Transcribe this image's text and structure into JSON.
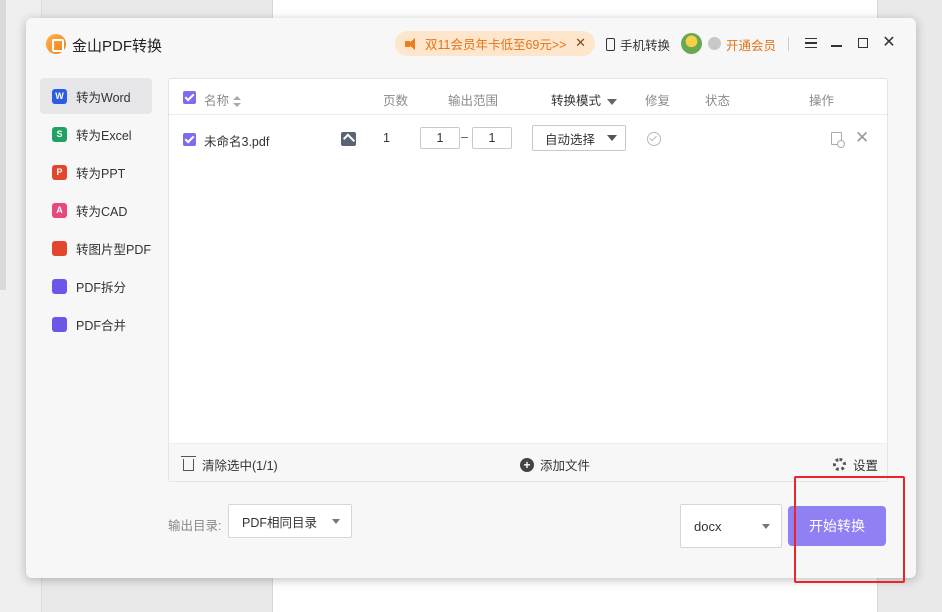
{
  "app": {
    "title": "金山PDF转换"
  },
  "promo": {
    "text": "双11会员年卡低至69元>>",
    "close": "✕"
  },
  "header": {
    "mobile_label": "手机转换",
    "vip_label": "开通会员"
  },
  "window_controls": {
    "close": "✕"
  },
  "sidebar": {
    "items": [
      {
        "label": "转为Word",
        "icon_letter": "W",
        "color": "#2b5ce6",
        "active": true
      },
      {
        "label": "转为Excel",
        "icon_letter": "S",
        "color": "#1ea362",
        "active": false
      },
      {
        "label": "转为PPT",
        "icon_letter": "P",
        "color": "#e2472e",
        "active": false
      },
      {
        "label": "转为CAD",
        "icon_letter": "A",
        "color": "#e8487f",
        "active": false
      },
      {
        "label": "转图片型PDF",
        "icon_letter": "",
        "color": "#e2472e",
        "active": false
      },
      {
        "label": "PDF拆分",
        "icon_letter": "",
        "color": "#6a56e8",
        "active": false
      },
      {
        "label": "PDF合并",
        "icon_letter": "",
        "color": "#6a56e8",
        "active": false
      }
    ]
  },
  "table": {
    "headers": {
      "name": "名称",
      "pages": "页数",
      "range": "输出范围",
      "mode": "转换模式",
      "repair": "修复",
      "status": "状态",
      "action": "操作"
    },
    "rows": [
      {
        "checked": true,
        "name": "未命名3.pdf",
        "pages": "1",
        "range_from": "1",
        "range_sep": "–",
        "range_to": "1",
        "mode": "自动选择",
        "delete": "✕"
      }
    ]
  },
  "footer": {
    "clear_label": "清除选中(1/1)",
    "add_label": "添加文件",
    "settings_label": "设置",
    "add_icon": "+"
  },
  "output": {
    "label": "输出目录:",
    "dir_value": "PDF相同目录",
    "format_value": "docx"
  },
  "start_button": {
    "label": "开始转换"
  },
  "colors": {
    "accent": "#8f81f4",
    "promo_bg": "#fde6cc",
    "promo_text": "#e2741a",
    "highlight": "#e8252a"
  }
}
